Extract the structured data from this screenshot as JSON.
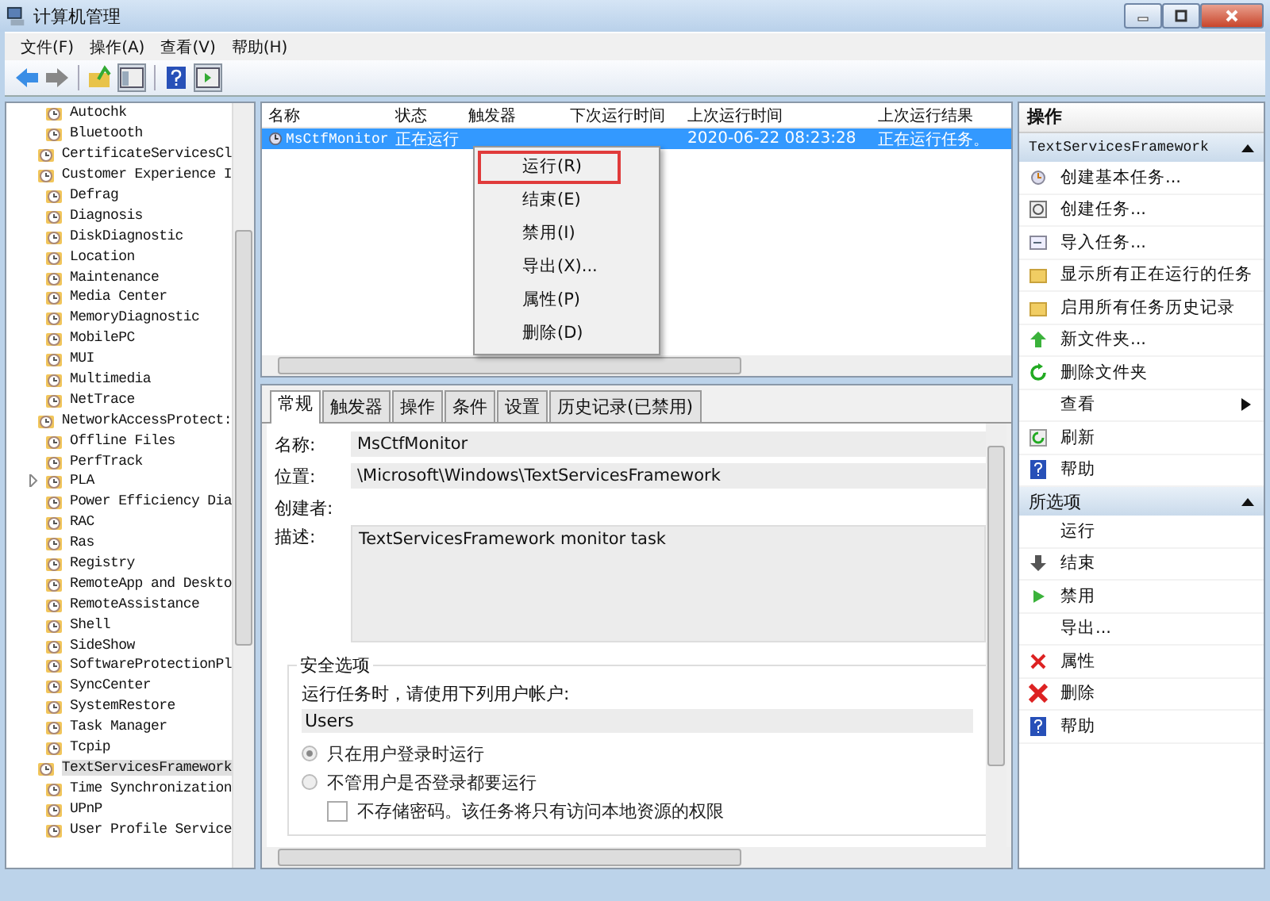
{
  "window": {
    "title": "计算机管理"
  },
  "menu": [
    "文件(F)",
    "操作(A)",
    "查看(V)",
    "帮助(H)"
  ],
  "tree": {
    "items": [
      {
        "label": "Autochk",
        "selected": false,
        "expandable": false
      },
      {
        "label": "Bluetooth",
        "selected": false,
        "expandable": false
      },
      {
        "label": "CertificateServicesCl",
        "selected": false,
        "expandable": false
      },
      {
        "label": "Customer Experience I",
        "selected": false,
        "expandable": false
      },
      {
        "label": "Defrag",
        "selected": false,
        "expandable": false
      },
      {
        "label": "Diagnosis",
        "selected": false,
        "expandable": false
      },
      {
        "label": "DiskDiagnostic",
        "selected": false,
        "expandable": false
      },
      {
        "label": "Location",
        "selected": false,
        "expandable": false
      },
      {
        "label": "Maintenance",
        "selected": false,
        "expandable": false
      },
      {
        "label": "Media Center",
        "selected": false,
        "expandable": false
      },
      {
        "label": "MemoryDiagnostic",
        "selected": false,
        "expandable": false
      },
      {
        "label": "MobilePC",
        "selected": false,
        "expandable": false
      },
      {
        "label": "MUI",
        "selected": false,
        "expandable": false
      },
      {
        "label": "Multimedia",
        "selected": false,
        "expandable": false
      },
      {
        "label": "NetTrace",
        "selected": false,
        "expandable": false
      },
      {
        "label": "NetworkAccessProtect:",
        "selected": false,
        "expandable": false
      },
      {
        "label": "Offline Files",
        "selected": false,
        "expandable": false
      },
      {
        "label": "PerfTrack",
        "selected": false,
        "expandable": false
      },
      {
        "label": "PLA",
        "selected": false,
        "expandable": true
      },
      {
        "label": "Power Efficiency Dia",
        "selected": false,
        "expandable": false
      },
      {
        "label": "RAC",
        "selected": false,
        "expandable": false
      },
      {
        "label": "Ras",
        "selected": false,
        "expandable": false
      },
      {
        "label": "Registry",
        "selected": false,
        "expandable": false
      },
      {
        "label": "RemoteApp and Deskto",
        "selected": false,
        "expandable": false
      },
      {
        "label": "RemoteAssistance",
        "selected": false,
        "expandable": false
      },
      {
        "label": "Shell",
        "selected": false,
        "expandable": false
      },
      {
        "label": "SideShow",
        "selected": false,
        "expandable": false
      },
      {
        "label": "SoftwareProtectionPl",
        "selected": false,
        "expandable": false
      },
      {
        "label": "SyncCenter",
        "selected": false,
        "expandable": false
      },
      {
        "label": "SystemRestore",
        "selected": false,
        "expandable": false
      },
      {
        "label": "Task Manager",
        "selected": false,
        "expandable": false
      },
      {
        "label": "Tcpip",
        "selected": false,
        "expandable": false
      },
      {
        "label": "TextServicesFramework",
        "selected": true,
        "expandable": false
      },
      {
        "label": "Time Synchronization",
        "selected": false,
        "expandable": false
      },
      {
        "label": "UPnP",
        "selected": false,
        "expandable": false
      },
      {
        "label": "User Profile Service",
        "selected": false,
        "expandable": false
      }
    ]
  },
  "table": {
    "columns": [
      "名称",
      "状态",
      "触发器",
      "下次运行时间",
      "上次运行时间",
      "上次运行结果"
    ],
    "rows": [
      {
        "cells": [
          "MsCtfMonitor",
          "正在运行",
          "",
          "",
          "2020-06-22 08:23:28",
          "正在运行任务。"
        ],
        "selected": true
      }
    ]
  },
  "context_menu": {
    "items": [
      {
        "label": "运行(R)",
        "selected": true
      },
      {
        "label": "结束(E)",
        "selected": false
      },
      {
        "label": "禁用(I)",
        "selected": false
      },
      {
        "label": "导出(X)...",
        "selected": false
      },
      {
        "label": "属性(P)",
        "selected": false
      },
      {
        "label": "删除(D)",
        "selected": false
      }
    ]
  },
  "details": {
    "tabs": [
      {
        "label": "常规",
        "selected": true
      },
      {
        "label": "触发器",
        "selected": false
      },
      {
        "label": "操作",
        "selected": false
      },
      {
        "label": "条件",
        "selected": false
      },
      {
        "label": "设置",
        "selected": false
      },
      {
        "label": "历史记录(已禁用)",
        "selected": false
      }
    ],
    "fields": [
      {
        "label": "名称:",
        "value": "MsCtfMonitor",
        "kind": "line"
      },
      {
        "label": "位置:",
        "value": "\\Microsoft\\Windows\\TextServicesFramework",
        "kind": "line"
      },
      {
        "label": "创建者:",
        "kind": "line"
      },
      {
        "label": "描述:",
        "value": "TextServicesFramework monitor task",
        "kind": "area"
      }
    ],
    "security": {
      "title": "安全选项",
      "prompt": "运行任务时，请使用下列用户帐户:",
      "account": "Users",
      "options": [
        {
          "label": "只在用户登录时运行",
          "selected": true,
          "kind": "radio"
        },
        {
          "label": "不管用户是否登录都要运行",
          "selected": false,
          "kind": "radio"
        },
        {
          "label": "不存储密码。该任务将只有访问本地资源的权限",
          "checked": false,
          "kind": "checkbox"
        }
      ]
    }
  },
  "actions": {
    "title": "操作",
    "sections": [
      {
        "title": "TextServicesFramework",
        "expanded": true,
        "items": [
          {
            "label": "创建基本任务...",
            "kind": "clock"
          },
          {
            "label": "创建任务...",
            "kind": "task"
          },
          {
            "label": "导入任务...",
            "kind": "import"
          },
          {
            "label": "显示所有正在运行的任务",
            "kind": "folder"
          },
          {
            "label": "启用所有任务历史记录",
            "kind": "folder"
          },
          {
            "label": "新文件夹...",
            "kind": "up"
          },
          {
            "label": "删除文件夹",
            "kind": "refresh"
          },
          {
            "label": "查看",
            "kind": "submenu"
          },
          {
            "label": "刷新",
            "kind": "refresh-box"
          },
          {
            "label": "帮助",
            "kind": "help"
          }
        ]
      },
      {
        "title": "所选项",
        "expanded": true,
        "items": [
          {
            "label": "运行",
            "kind": "none"
          },
          {
            "label": "结束",
            "kind": "down"
          },
          {
            "label": "禁用",
            "kind": "play"
          },
          {
            "label": "导出...",
            "kind": "none"
          },
          {
            "label": "属性",
            "kind": "x"
          },
          {
            "label": "删除",
            "kind": "x-big"
          },
          {
            "label": "帮助",
            "kind": "help"
          }
        ]
      }
    ]
  }
}
